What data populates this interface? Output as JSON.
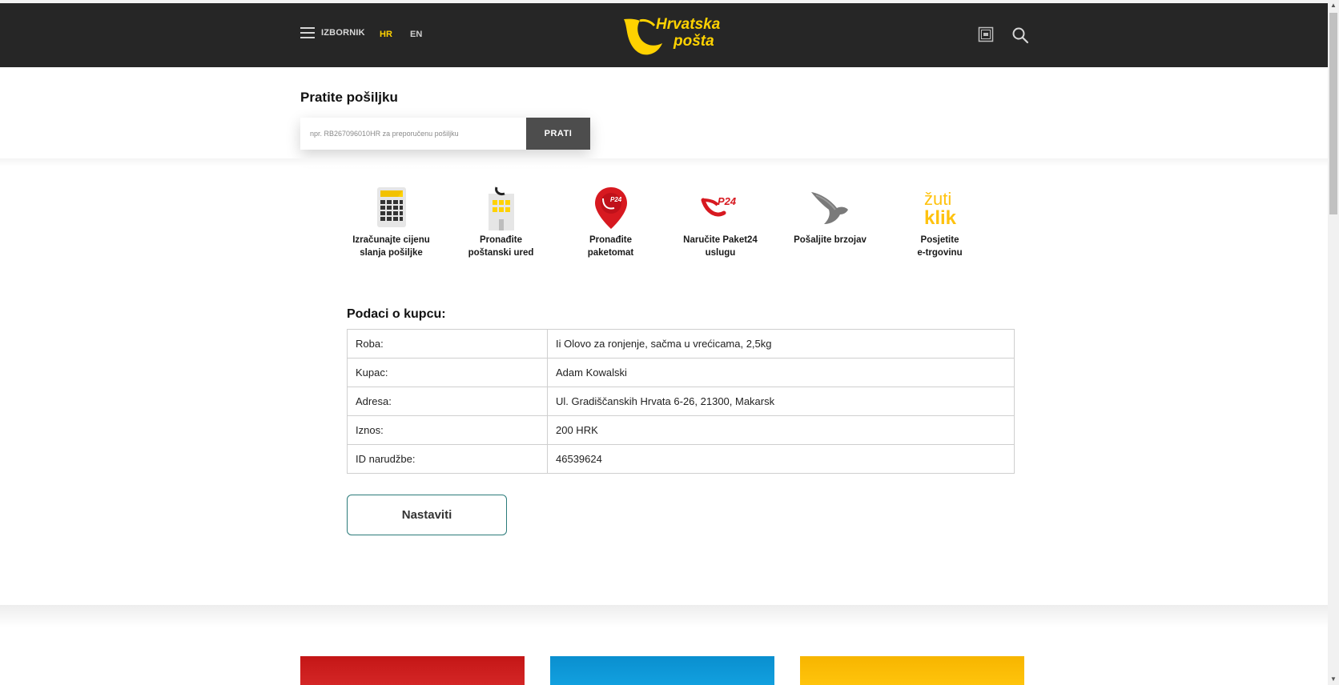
{
  "header": {
    "menu_label": "IZBORNIK",
    "lang_hr": "HR",
    "lang_en": "EN",
    "logo_line1": "Hrvatska",
    "logo_line2": "pošta"
  },
  "tracking": {
    "title": "Pratite pošiljku",
    "placeholder": "npr. RB267096010HR za preporučenu pošiljku",
    "button_label": "PRATI"
  },
  "quick_links": [
    {
      "label": "Izračunajte cijenu\nslanja pošiljke",
      "icon": "calculator-icon"
    },
    {
      "label": "Pronađite\npoštanski ured",
      "icon": "post-office-icon"
    },
    {
      "label": "Pronađite\npaketomat",
      "icon": "parcel-locker-pin-icon"
    },
    {
      "label": "Naručite Paket24\nuslugu",
      "icon": "paket24-icon"
    },
    {
      "label": "Pošaljite brzojav",
      "icon": "telegram-bird-icon"
    },
    {
      "label": "Posjetite\ne-trgovinu",
      "icon": "zuti-klik-icon",
      "logo_text_top": "žuti",
      "logo_text_bottom": "klik"
    }
  ],
  "customer": {
    "title": "Podaci o kupcu:",
    "rows": [
      {
        "key": "Roba:",
        "value": "Ii Olovo za ronjenje, sačma u vrećicama, 2,5kg"
      },
      {
        "key": "Kupac:",
        "value": "Adam Kowalski"
      },
      {
        "key": "Adresa:",
        "value": "Ul. Gradiščanskih Hrvata 6-26, 21300, Makarsk"
      },
      {
        "key": "Iznos:",
        "value": "200 HRK"
      },
      {
        "key": "ID narudžbe:",
        "value": "46539624"
      }
    ],
    "continue_label": "Nastaviti"
  },
  "colors": {
    "header_bg": "#262626",
    "brand_yellow": "#ffd200",
    "button_dark": "#4d4d4d",
    "continue_border": "#2b7b7a"
  }
}
